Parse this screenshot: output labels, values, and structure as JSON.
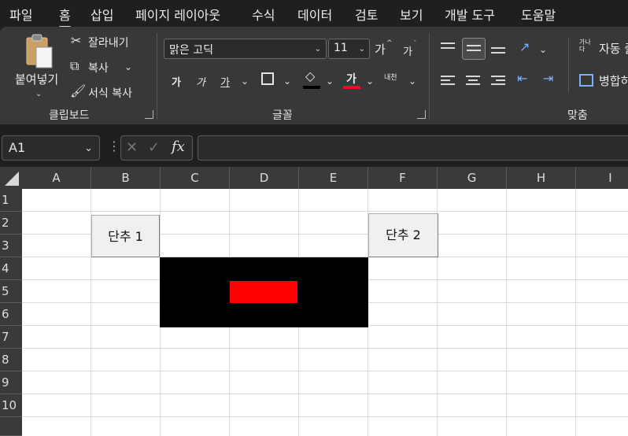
{
  "menu": {
    "tabs": [
      "파일",
      "홈",
      "삽입",
      "페이지 레이아웃",
      "수식",
      "데이터",
      "검토",
      "보기",
      "개발 도구",
      "도움말"
    ],
    "active_tab": "홈"
  },
  "ribbon": {
    "clipboard": {
      "paste_label": "붙여넣기",
      "cut_label": "잘라내기",
      "copy_label": "복사",
      "format_painter_label": "서식 복사",
      "group_label": "클립보드"
    },
    "font": {
      "font_name": "맑은 고딕",
      "font_size": "11",
      "increase_size": "가",
      "decrease_size": "가",
      "bold": "가",
      "italic": "가",
      "underline": "가",
      "font_color_glyph": "가",
      "phonetic_label": "내천",
      "group_label": "글꼴",
      "fill_color": "#000000",
      "font_color": "#e81123"
    },
    "alignment": {
      "wrap_text_label": "자동 줄",
      "wrap_icon_text": "가나다",
      "merge_label": "병합하",
      "group_label": "맞춤"
    }
  },
  "formula_bar": {
    "name_box": "A1",
    "formula": ""
  },
  "sheet": {
    "columns": [
      "A",
      "B",
      "C",
      "D",
      "E",
      "F",
      "G",
      "H",
      "I"
    ],
    "rows": [
      "1",
      "2",
      "3",
      "4",
      "5",
      "6",
      "7",
      "8",
      "9",
      "10"
    ],
    "buttons": [
      {
        "label": "단추 1"
      },
      {
        "label": "단추 2"
      }
    ],
    "shapes": {
      "outer_color": "#000000",
      "inner_color": "#ff0000"
    }
  }
}
